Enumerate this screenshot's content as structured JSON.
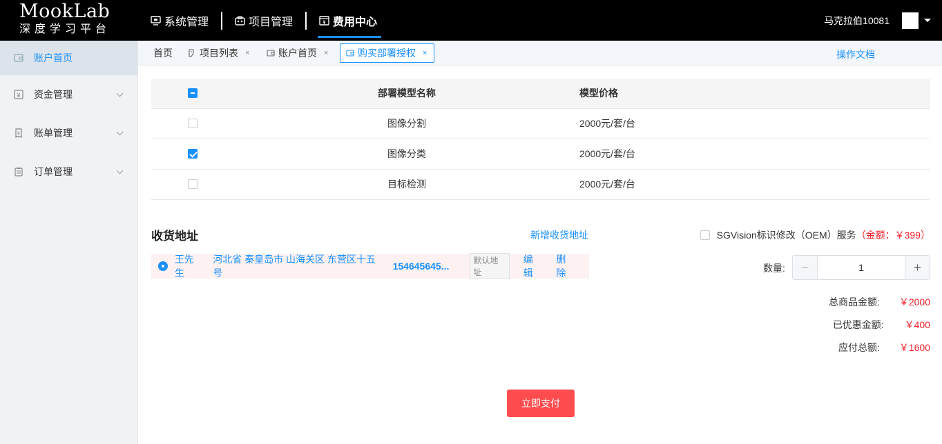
{
  "brand": {
    "name": "MookLab",
    "subtitle": "深度学习平台"
  },
  "topnav": [
    {
      "label": "系统管理",
      "icon": "monitor-icon"
    },
    {
      "label": "项目管理",
      "icon": "project-icon"
    },
    {
      "label": "费用中心",
      "icon": "billing-icon",
      "active": true
    }
  ],
  "user": {
    "name": "马克拉伯10081"
  },
  "sidebar": {
    "items": [
      {
        "label": "账户首页",
        "icon": "wallet-icon",
        "active": true
      },
      {
        "label": "资金管理",
        "icon": "fund-icon",
        "expandable": true
      },
      {
        "label": "账单管理",
        "icon": "bill-icon",
        "expandable": true
      },
      {
        "label": "订单管理",
        "icon": "order-icon",
        "expandable": true
      }
    ]
  },
  "tabs": [
    {
      "label": "首页"
    },
    {
      "label": "项目列表",
      "closable": "×"
    },
    {
      "label": "账户首页",
      "closable": "×"
    },
    {
      "label": "购买部署授权",
      "closable": "×",
      "active": true
    }
  ],
  "doc_link": "操作文档",
  "table": {
    "headers": [
      "部署模型名称",
      "模型价格"
    ],
    "rows": [
      {
        "name": "图像分割",
        "price": "2000元/套/台",
        "checked": false
      },
      {
        "name": "图像分类",
        "price": "2000元/套/台",
        "checked": true
      },
      {
        "name": "目标检测",
        "price": "2000元/套/台",
        "checked": false
      }
    ]
  },
  "address": {
    "title": "收货地址",
    "add_label": "新增收货地址",
    "entry": {
      "name": "王先生",
      "address": "河北省 秦皇岛市 山海关区 东营区十五号",
      "phone": "154645645...",
      "tag": "默认地址",
      "edit": "编辑",
      "delete": "删除"
    }
  },
  "oem": {
    "label": "SGVision标识修改（OEM）服务",
    "price": "（金额：￥399）"
  },
  "quantity": {
    "label": "数量:",
    "value": "1",
    "minus": "−",
    "plus": "+"
  },
  "summary": {
    "total_label": "总商品金额:",
    "total": "￥2000",
    "discount_label": "已优惠金额:",
    "discount": "￥400",
    "payable_label": "应付总额:",
    "payable": "￥1600"
  },
  "pay_button": "立即支付",
  "colors": {
    "primary": "#1890ff",
    "danger": "#ff4d4f",
    "price_red": "#f5222d",
    "topbar": "#000000"
  }
}
